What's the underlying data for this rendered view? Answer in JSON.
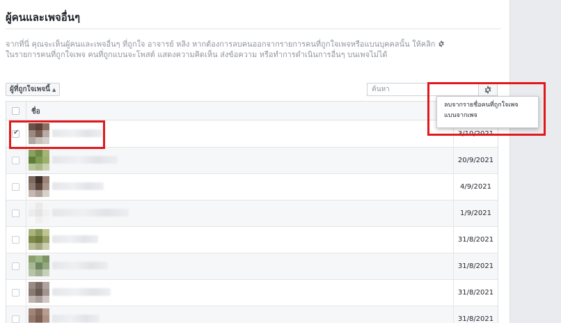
{
  "page": {
    "title": "ผู้คนและเพจอื่นๆ",
    "description_line1": "จากที่นี่ คุณจะเห็นผู้คนและเพจอื่นๆ ที่ถูกใจ อาจารย์ หลิง หากต้องการลบคนออกจากรายการคนที่ถูกใจเพจหรือแบนบุคคลนั้น ให้คลิก",
    "description_line2": "ในรายการคนที่ถูกใจเพจ คนที่ถูกแบนจะโพสต์ แสดงความคิดเห็น ส่งข้อความ หรือทำการดำเนินการอื่นๆ บนเพจไม่ได้"
  },
  "toolbar": {
    "filter_label": "ผู้ที่ถูกใจเพจนี้",
    "search_placeholder": "ค้นหา"
  },
  "table": {
    "header_name": "ชื่อ",
    "rows": [
      {
        "checked": true,
        "date": "3/10/2021",
        "avatar": [
          "#6b5248",
          "#5a4038",
          "#8a6e60",
          "#9a8a80",
          "#7a5e52",
          "#b8aaa4",
          "#b0a8a4",
          "#c8c0bc",
          "#d6d0cc"
        ]
      },
      {
        "checked": false,
        "date": "20/9/2021",
        "avatar": [
          "#8aa060",
          "#6e8a46",
          "#a4b478",
          "#5e7e3a",
          "#7e9a50",
          "#9ab06c",
          "#b8c498",
          "#a8b888",
          "#c8d0b0"
        ]
      },
      {
        "checked": false,
        "date": "4/9/2021",
        "avatar": [
          "#7a6a60",
          "#3e3028",
          "#9a8478",
          "#8e7a70",
          "#5a463c",
          "#a89488",
          "#c4b8b0",
          "#b0a098",
          "#d8d0ca"
        ]
      },
      {
        "checked": false,
        "date": "1/9/2021",
        "avatar": [
          "#f4f4f4",
          "#eaeaea",
          "#f6f6f6",
          "#ececec",
          "#e4e4e4",
          "#f0f0f0",
          "#f8f8f8",
          "#efefef",
          "#f5f5f5"
        ]
      },
      {
        "checked": false,
        "date": "31/8/2021",
        "avatar": [
          "#a8b47a",
          "#8a9a60",
          "#c0c490",
          "#7e8a4a",
          "#6e7a3e",
          "#9aa46a",
          "#b8bc94",
          "#a4a880",
          "#ccccb0"
        ]
      },
      {
        "checked": false,
        "date": "31/8/2021",
        "avatar": [
          "#8aa070",
          "#9ab480",
          "#7e9468",
          "#a8b890",
          "#6e8660",
          "#94a87e",
          "#b8c4a8",
          "#a0b090",
          "#c8d0bc"
        ]
      },
      {
        "checked": false,
        "date": "31/8/2021",
        "avatar": [
          "#9a8a84",
          "#7a6a64",
          "#b0a29c",
          "#8a7a74",
          "#6a5a54",
          "#a49490",
          "#c0b4b0",
          "#aca09c",
          "#d0c8c4"
        ]
      },
      {
        "checked": false,
        "date": "31/8/2021",
        "avatar": [
          "#a08478",
          "#84685c",
          "#b89c90",
          "#94786c",
          "#7a5e52",
          "#ac9084",
          "#c8b4aa",
          "#b8a49a",
          "#d8c8c0"
        ]
      }
    ]
  },
  "menu": {
    "items": [
      {
        "label": "ลบจากรายชื่อคนที่ถูกใจเพจ"
      },
      {
        "label": "แบนจากเพจ"
      }
    ]
  },
  "icons": {
    "gear": "gear-icon",
    "check": "checkmark-icon",
    "sort": "updown-arrows-icon"
  },
  "colors": {
    "highlight": "#e2171b",
    "muted_text": "#90949c",
    "border": "#dddfe2",
    "gutter": "#e9ebee"
  }
}
